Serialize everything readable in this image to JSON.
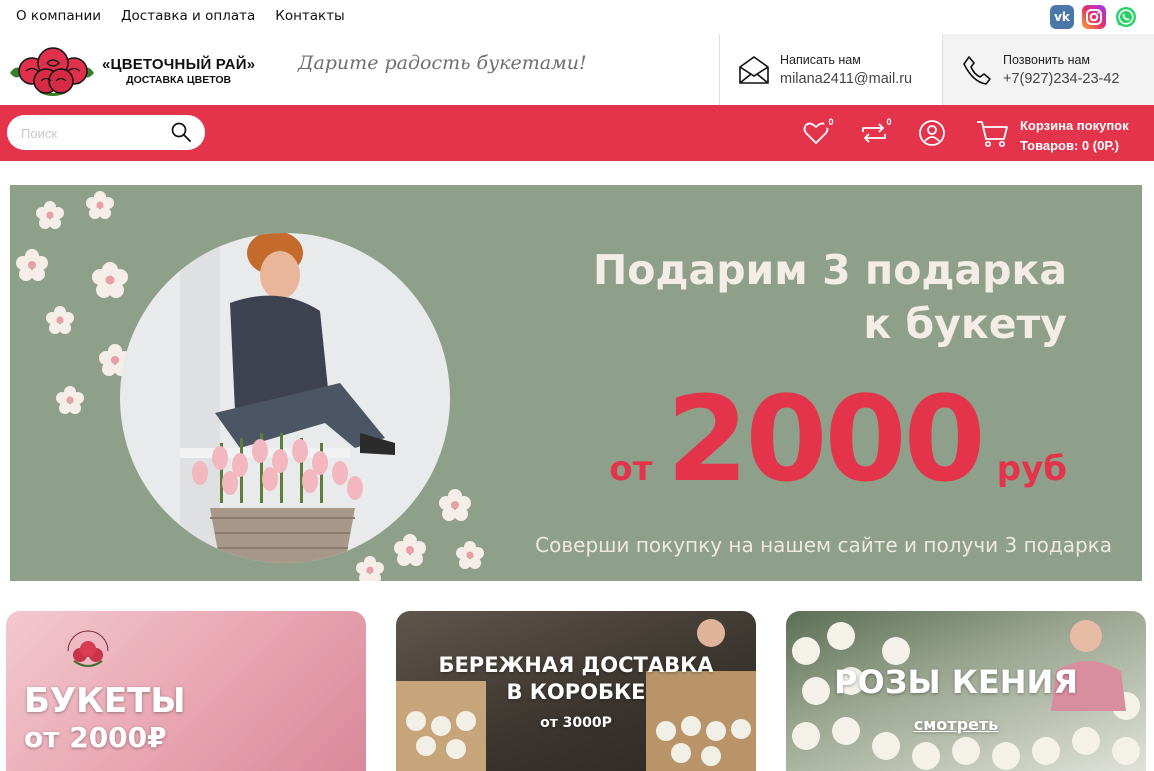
{
  "topnav": {
    "items": [
      "О компании",
      "Доставка и оплата",
      "Контакты"
    ]
  },
  "social": {
    "vk": "vk-icon",
    "instagram": "instagram-icon",
    "whatsapp": "whatsapp-icon"
  },
  "brand": {
    "name": "«ЦВЕТОЧНЫЙ РАЙ»",
    "subtitle": "ДОСТАВКА ЦВЕТОВ",
    "slogan": "Дарите радость букетами!"
  },
  "contacts": {
    "mail": {
      "label": "Написать нам",
      "value": "milana2411@mail.ru"
    },
    "phone": {
      "label": "Позвонить нам",
      "value": "+7(927)234-23-42"
    }
  },
  "search": {
    "placeholder": "Поиск"
  },
  "toolbar": {
    "favorites_count": "0",
    "compare_count": "0",
    "cart_title": "Корзина покупок",
    "cart_summary": "Товаров: 0 (0Р.)"
  },
  "banner": {
    "title_line1": "Подарим 3 подарка",
    "title_line2": "к букету",
    "price_prefix": "от",
    "price_value": "2000",
    "price_suffix": "руб",
    "subtitle": "Соверши покупку на нашем сайте и получи 3 подарка"
  },
  "cards": [
    {
      "line1": "БУКЕТЫ",
      "line2": "от 2000₽"
    },
    {
      "line1": "БЕРЕЖНАЯ ДОСТАВКА",
      "line2": "В КОРОБКЕ",
      "line3": "от 3000Р"
    },
    {
      "line1": "РОЗЫ КЕНИЯ",
      "line2": "смотреть"
    }
  ],
  "colors": {
    "accent": "#e3344c",
    "banner_bg": "#8fa08a"
  }
}
